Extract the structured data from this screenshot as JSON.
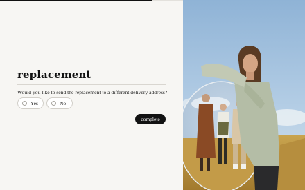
{
  "progress": {
    "value": 0.5,
    "fill_color": "#111111",
    "track_color": "#e3e1dc"
  },
  "form": {
    "title": "replacement",
    "question": "Would you like to send the replacement to a different delivery address?",
    "options": [
      {
        "label": "Yes"
      },
      {
        "label": "No"
      }
    ],
    "submit_label": "complete"
  },
  "colors": {
    "accent": "#121212",
    "panel_background": "#f7f6f3",
    "sky": "#a9c6e2",
    "field": "#caa14e"
  }
}
